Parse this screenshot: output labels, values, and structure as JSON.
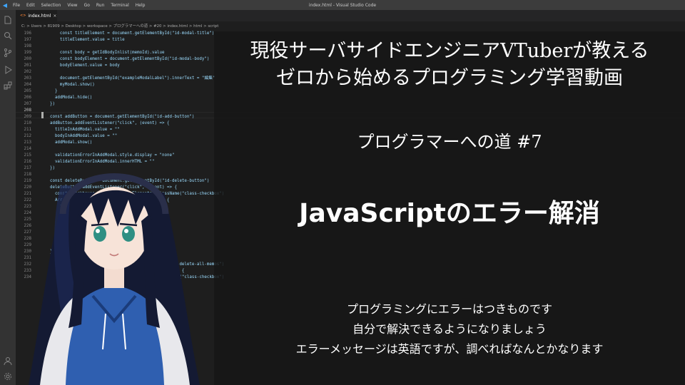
{
  "window": {
    "title": "index.html - Visual Studio Code",
    "menu": [
      "File",
      "Edit",
      "Selection",
      "View",
      "Go",
      "Run",
      "Terminal",
      "Help"
    ]
  },
  "tab": {
    "label": "index.html"
  },
  "breadcrumb": "C: > Users > 81909 > Desktop > workspace > プログラマーへの道 > #20 > index.html > html > script",
  "code_lines": [
    {
      "n": "196",
      "text": "        const titleElement = document.getElementById(\"id-modal-title\")"
    },
    {
      "n": "197",
      "text": "        titleElement.value = title"
    },
    {
      "n": "198",
      "text": ""
    },
    {
      "n": "199",
      "text": "        const body = getIdBodyInlist(memoId).value"
    },
    {
      "n": "200",
      "text": "        const bodyElement = document.getElementById(\"id-modal-body\")"
    },
    {
      "n": "201",
      "text": "        bodyElement.value = body"
    },
    {
      "n": "202",
      "text": ""
    },
    {
      "n": "203",
      "text": "        document.getElementById(\"exampleModalLabel\").innerText = \"編集\""
    },
    {
      "n": "204",
      "text": "        myModal.show()"
    },
    {
      "n": "205",
      "text": "      }"
    },
    {
      "n": "206",
      "text": "      addModal.hide()"
    },
    {
      "n": "207",
      "text": "    })"
    },
    {
      "n": "208",
      "text": ""
    },
    {
      "n": "209",
      "text": "    const addButton = document.getElementById(\"id-add-button\")"
    },
    {
      "n": "210",
      "text": "    addButton.addEventListener(\"click\", (event) => {"
    },
    {
      "n": "211",
      "text": "      titleInAddModal.value = \"\""
    },
    {
      "n": "212",
      "text": "      bodyInAddModal.value = \"\""
    },
    {
      "n": "213",
      "text": "      addModal.show()"
    },
    {
      "n": "214",
      "text": ""
    },
    {
      "n": "215",
      "text": "      validationErrorInAddModal.style.display = \"none\""
    },
    {
      "n": "216",
      "text": "      validationErrorInAddModal.innerHTML = \"\""
    },
    {
      "n": "217",
      "text": "    })"
    },
    {
      "n": "218",
      "text": ""
    },
    {
      "n": "219",
      "text": "    const deleteButton = document.getElementById(\"id-delete-button\")"
    },
    {
      "n": "220",
      "text": "    deleteButton.addEventListener(\"click\", (event) => {"
    },
    {
      "n": "221",
      "text": "      const checkboxes = document.getElementsByClassName(\"class-checkbox\")"
    },
    {
      "n": "222",
      "text": "      Array.from(checkboxes).forEach((checkbox) => {"
    },
    {
      "n": "223",
      "text": "        if (checkbox.checked) {"
    },
    {
      "n": "224",
      "text": "          return"
    },
    {
      "n": "225",
      "text": "        }"
    },
    {
      "n": "226",
      "text": ""
    },
    {
      "n": "227",
      "text": "        const memoId = checkbox.dataset.memoId"
    },
    {
      "n": "228",
      "text": "        document.getElementById(memoId).remove()"
    },
    {
      "n": "229",
      "text": "      })"
    },
    {
      "n": "230",
      "text": "    })"
    },
    {
      "n": "231",
      "text": ""
    },
    {
      "n": "232",
      "text": "    const deleteAllButton = document.getElementById(\"id-delete-all-memos\")"
    },
    {
      "n": "233",
      "text": "    deleteAllButton.addEventListener(\"click\", (event) => {"
    },
    {
      "n": "234",
      "text": "      const checkboxes = document.getElementsByClassName(\"class-checkbox\")"
    }
  ],
  "overlay": {
    "heading1": "現役サーバサイドエンジニアVTuberが教える",
    "heading2": "ゼロから始めるプログラミング学習動画",
    "episode": "プログラマーへの道 #7",
    "topic": "JavaScriptのエラー解消",
    "note1": "プログラミングにエラーはつきものです",
    "note2": "自分で解決できるようになりましょう",
    "note3": "エラーメッセージは英語ですが、調べればなんとかなります"
  },
  "icons": {
    "activity": [
      "files-icon",
      "search-icon",
      "source-control-icon",
      "run-debug-icon",
      "extensions-icon",
      "account-icon",
      "settings-gear-icon"
    ]
  },
  "colors": {
    "editor_bg": "#1e1e1e",
    "activity_bar": "#333333",
    "title_bar": "#3c3c3c",
    "vscode_blue": "#3ea6ff",
    "avatar_hoodie": "#2f5fb0",
    "avatar_hair": "#141a33"
  }
}
